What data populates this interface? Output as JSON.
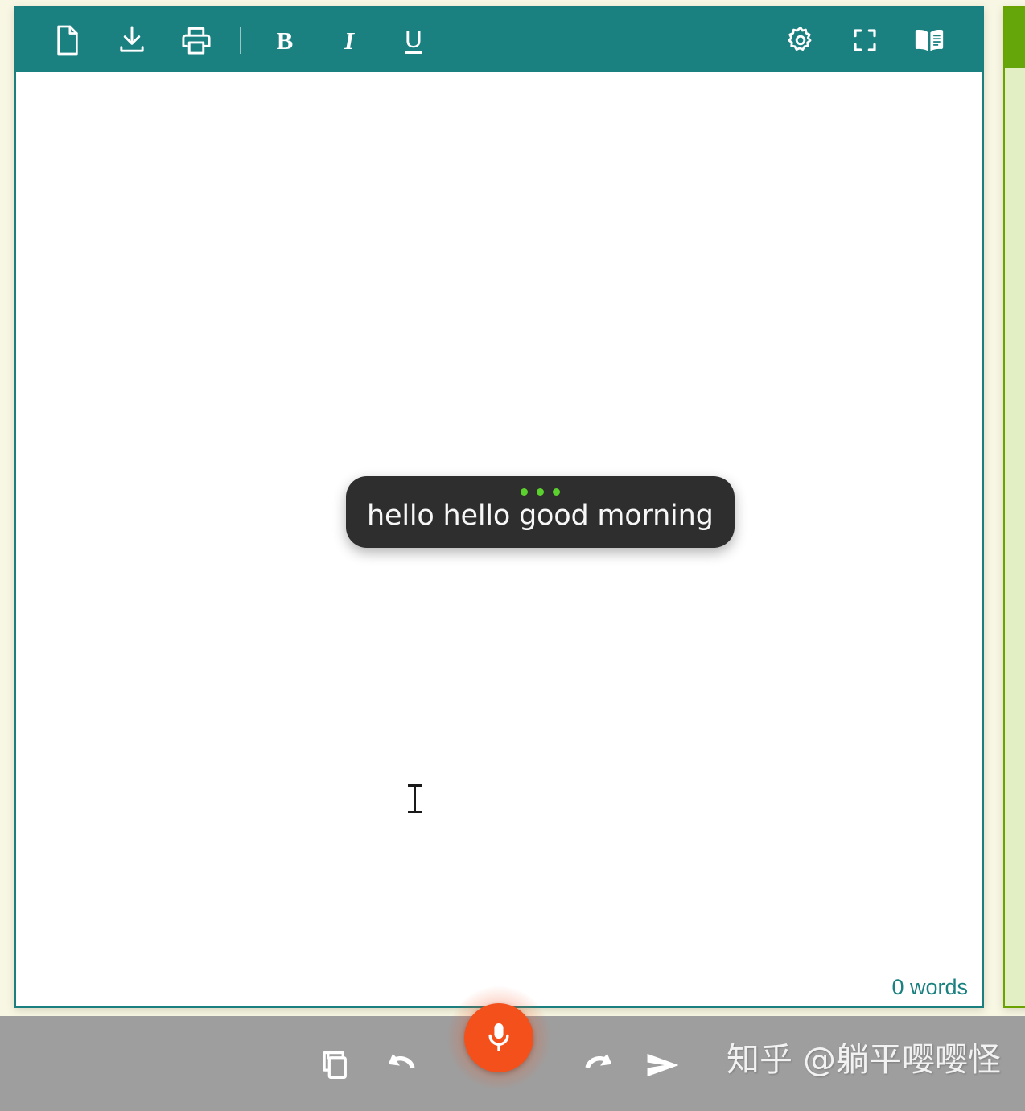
{
  "app": {
    "title": "Speech Notes Editor",
    "accent_teal": "#1a8080",
    "accent_orange": "#f4501b",
    "page_background": "#f8f7e4",
    "bottom_bar_background": "#9e9e9e",
    "side_panel_green": "#65a60a"
  },
  "toolbar": {
    "new_document_label": "New document",
    "new_document_icon": "document-icon",
    "download_label": "Download",
    "download_icon": "download-icon",
    "print_label": "Print",
    "print_icon": "printer-icon",
    "bold_label": "B",
    "bold_icon": "bold-icon",
    "italic_label": "I",
    "italic_icon": "italic-icon",
    "underline_label": "U",
    "underline_icon": "underline-icon",
    "settings_label": "Settings",
    "settings_icon": "gear-icon",
    "fullscreen_label": "Fullscreen",
    "fullscreen_icon": "fullscreen-icon",
    "reader_label": "Reader",
    "reader_icon": "book-icon"
  },
  "editor": {
    "content": "",
    "placeholder": "",
    "word_count": "0 words"
  },
  "transcript": {
    "text": "hello hello good morning",
    "listening_dots": 3,
    "dot_color": "#5ad12c",
    "bubble_color": "#2e2e2e"
  },
  "bottom_bar": {
    "copy_label": "Copy",
    "copy_icon": "copy-icon",
    "undo_label": "Undo",
    "undo_icon": "undo-icon",
    "mic_label": "Record",
    "mic_icon": "microphone-icon",
    "redo_label": "Redo",
    "redo_icon": "redo-icon",
    "send_label": "Send",
    "send_icon": "send-icon"
  },
  "watermark": {
    "text": "知乎 @躺平嘤嘤怪"
  },
  "side_panel": {
    "visible_portion": "partial"
  }
}
